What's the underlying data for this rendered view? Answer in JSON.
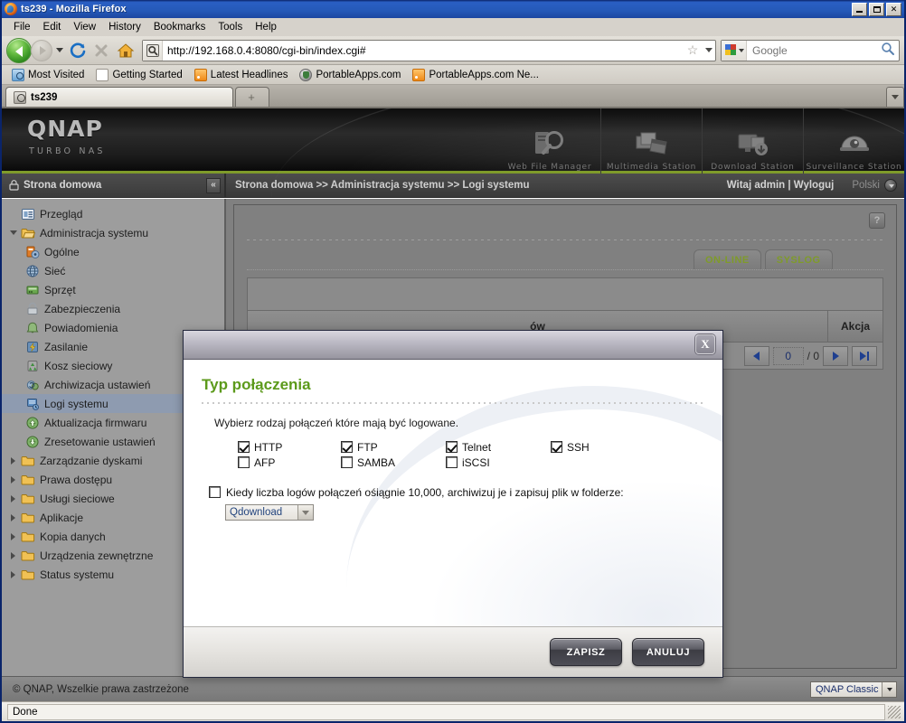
{
  "browser": {
    "window_title": "ts239 - Mozilla Firefox",
    "menu": [
      "File",
      "Edit",
      "View",
      "History",
      "Bookmarks",
      "Tools",
      "Help"
    ],
    "url": "http://192.168.0.4:8080/cgi-bin/index.cgi#",
    "search_placeholder": "Google",
    "bookmarks": [
      {
        "label": "Most Visited",
        "icon": "folder-star-icon"
      },
      {
        "label": "Getting Started",
        "icon": "page-icon"
      },
      {
        "label": "Latest Headlines",
        "icon": "rss-icon"
      },
      {
        "label": "PortableApps.com",
        "icon": "portableapps-icon"
      },
      {
        "label": "PortableApps.com Ne...",
        "icon": "rss-icon"
      }
    ],
    "tabs": [
      {
        "label": "ts239",
        "active": true
      },
      {
        "label": "+",
        "active": false
      }
    ],
    "status": "Done"
  },
  "banner": {
    "logo": "QNAP",
    "logo_sub": "TURBO NAS",
    "apps": [
      {
        "label": "Web File Manager",
        "icon": "file-magnifier-icon"
      },
      {
        "label": "Multimedia Station",
        "icon": "photos-clapboard-icon"
      },
      {
        "label": "Download Station",
        "icon": "download-monitor-icon"
      },
      {
        "label": "Surveillance Station",
        "icon": "dome-camera-icon"
      }
    ]
  },
  "header": {
    "home_label": "Strona domowa",
    "collapse_icon": "«",
    "breadcrumb": "Strona domowa >> Administracja systemu >> Logi systemu",
    "greeting": "Witaj admin | Wyloguj",
    "language": "Polski"
  },
  "sidebar": {
    "items": [
      {
        "label": "Przegląd",
        "level": 1,
        "icon": "overview-icon",
        "twisty": "none",
        "selected": false
      },
      {
        "label": "Administracja systemu",
        "level": 1,
        "icon": "folder-open-icon",
        "twisty": "open",
        "selected": false
      },
      {
        "label": "Ogólne",
        "level": 2,
        "icon": "general-icon",
        "twisty": "none",
        "selected": false
      },
      {
        "label": "Sieć",
        "level": 2,
        "icon": "network-icon",
        "twisty": "none",
        "selected": false
      },
      {
        "label": "Sprzęt",
        "level": 2,
        "icon": "hardware-icon",
        "twisty": "none",
        "selected": false
      },
      {
        "label": "Zabezpieczenia",
        "level": 2,
        "icon": "lock-icon",
        "twisty": "none",
        "selected": false
      },
      {
        "label": "Powiadomienia",
        "level": 2,
        "icon": "notification-icon",
        "twisty": "none",
        "selected": false
      },
      {
        "label": "Zasilanie",
        "level": 2,
        "icon": "power-icon",
        "twisty": "none",
        "selected": false
      },
      {
        "label": "Kosz sieciowy",
        "level": 2,
        "icon": "recycle-bin-icon",
        "twisty": "none",
        "selected": false
      },
      {
        "label": "Archiwizacja ustawień",
        "level": 2,
        "icon": "backup-icon",
        "twisty": "none",
        "selected": false
      },
      {
        "label": "Logi systemu",
        "level": 2,
        "icon": "system-logs-icon",
        "twisty": "none",
        "selected": true
      },
      {
        "label": "Aktualizacja firmwaru",
        "level": 2,
        "icon": "firmware-update-icon",
        "twisty": "none",
        "selected": false
      },
      {
        "label": "Zresetowanie ustawień",
        "level": 2,
        "icon": "reset-icon",
        "twisty": "none",
        "selected": false
      },
      {
        "label": "Zarządzanie dyskami",
        "level": 1,
        "icon": "folder-icon",
        "twisty": "closed",
        "selected": false
      },
      {
        "label": "Prawa dostępu",
        "level": 1,
        "icon": "folder-icon",
        "twisty": "closed",
        "selected": false
      },
      {
        "label": "Usługi sieciowe",
        "level": 1,
        "icon": "folder-icon",
        "twisty": "closed",
        "selected": false
      },
      {
        "label": "Aplikacje",
        "level": 1,
        "icon": "folder-icon",
        "twisty": "closed",
        "selected": false
      },
      {
        "label": "Kopia danych",
        "level": 1,
        "icon": "folder-icon",
        "twisty": "closed",
        "selected": false
      },
      {
        "label": "Urządzenia zewnętrzne",
        "level": 1,
        "icon": "folder-icon",
        "twisty": "closed",
        "selected": false
      },
      {
        "label": "Status systemu",
        "level": 1,
        "icon": "folder-icon",
        "twisty": "closed",
        "selected": false
      }
    ]
  },
  "main": {
    "help_label": "?",
    "tabs": [
      {
        "label": "ON-LINE"
      },
      {
        "label": "SYSLOG"
      }
    ],
    "table_headers": [
      "ów",
      "Akcja"
    ],
    "pager": {
      "current": "0",
      "total": "/ 0"
    }
  },
  "modal": {
    "close_label": "X",
    "title": "Typ połączenia",
    "description": "Wybierz rodzaj połączeń które mają być logowane.",
    "checkboxes": [
      {
        "label": "HTTP",
        "checked": true
      },
      {
        "label": "FTP",
        "checked": true
      },
      {
        "label": "Telnet",
        "checked": true
      },
      {
        "label": "SSH",
        "checked": true
      },
      {
        "label": "AFP",
        "checked": false
      },
      {
        "label": "SAMBA",
        "checked": false
      },
      {
        "label": "iSCSI",
        "checked": false
      },
      {
        "label": "",
        "checked": null
      }
    ],
    "archive": {
      "checked": false,
      "label": "Kiedy liczba logów połączeń ośiągnie 10,000, archiwizuj je i zapisuj plik w folderze:",
      "folder": "Qdownload"
    },
    "save_label": "ZAPISZ",
    "cancel_label": "ANULUJ"
  },
  "footer": {
    "copyright": "© QNAP, Wszelkie prawa zastrzeżone",
    "theme": "QNAP Classic"
  },
  "colors": {
    "qnap_green": "#7f9b2a",
    "modal_title_green": "#5c9a1b",
    "titlebar_blue": "#2559b8",
    "selected_row": "#8e9bb0"
  }
}
